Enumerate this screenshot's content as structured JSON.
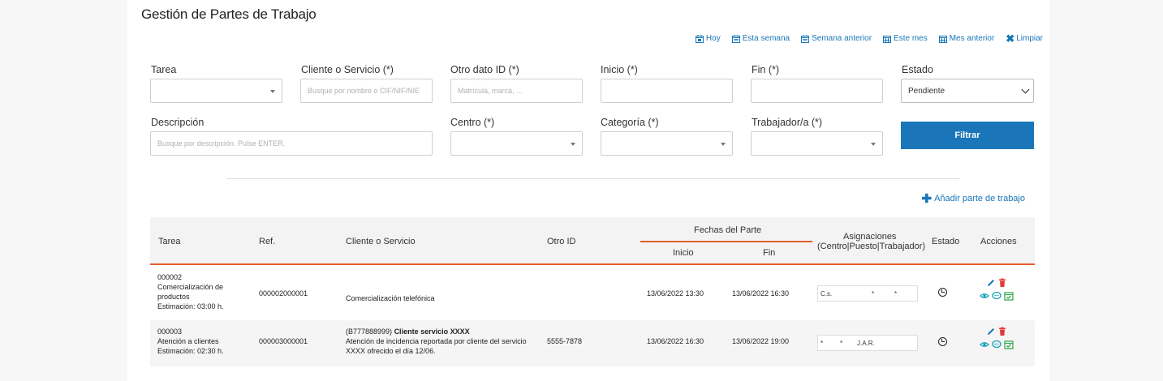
{
  "page": {
    "title": "Gestión de Partes de Trabajo"
  },
  "quick_dates": [
    {
      "label": "Hoy"
    },
    {
      "label": "Esta semana"
    },
    {
      "label": "Semana anterior"
    },
    {
      "label": "Este mes"
    },
    {
      "label": "Mes anterior"
    },
    {
      "label": "Limpiar"
    }
  ],
  "filters": {
    "tarea": {
      "label": "Tarea",
      "value": ""
    },
    "cliente": {
      "label": "Cliente o Servicio (*)",
      "placeholder": "Busque por nombre o CIF/NIF/NIE"
    },
    "otro_dato": {
      "label": "Otro dato ID (*)",
      "placeholder": "Matrícula, marca, ..."
    },
    "inicio": {
      "label": "Inicio (*)",
      "value": ""
    },
    "fin": {
      "label": "Fin (*)",
      "value": ""
    },
    "estado": {
      "label": "Estado",
      "value": "Pendiente"
    },
    "descripcion": {
      "label": "Descripción",
      "placeholder": "Busque por descripción. Pulse ENTER."
    },
    "centro": {
      "label": "Centro (*)",
      "value": ""
    },
    "categoria": {
      "label": "Categoría (*)",
      "value": ""
    },
    "trabajador": {
      "label": "Trabajador/a (*)",
      "value": ""
    },
    "filter_button": "Filtrar"
  },
  "add_link": "Añadir parte de trabajo",
  "table": {
    "headers": {
      "tarea": "Tarea",
      "ref": "Ref.",
      "cliente": "Cliente o Servicio",
      "otro_id": "Otro ID",
      "fechas_group": "Fechas del Parte",
      "inicio": "Inicio",
      "fin": "Fin",
      "asignaciones_1": "Asignaciones",
      "asignaciones_2": "(Centro|Puesto|Trabajador)",
      "estado": "Estado",
      "acciones": "Acciones"
    },
    "rows": [
      {
        "tarea_code": "000002",
        "tarea_name_1": "Comercialización de",
        "tarea_name_2": "productos",
        "estimacion": "Estimación: 03:00 h.",
        "ref": "000002000001",
        "cliente_line1_prefix": "",
        "cliente_line1_bold": "",
        "cliente_line2": "Comercialización telefónica",
        "cliente_line3": "",
        "otro_id": "",
        "inicio": "13/06/2022 13:30",
        "fin": "13/06/2022 16:30",
        "asg_centro": "C.s.",
        "asg_puesto": "*",
        "asg_trabajador": "*"
      },
      {
        "tarea_code": "000003",
        "tarea_name_1": "Atención a clientes",
        "tarea_name_2": "",
        "estimacion": "Estimación: 02:30 h.",
        "ref": "000003000001",
        "cliente_line1_prefix": "(B777888999)",
        "cliente_line1_bold": "Cliente servicio XXXX",
        "cliente_line2": "Atención de incidencia reportada por cliente del servicio",
        "cliente_line3": "XXXX ofrecido el día 12/06.",
        "otro_id": "5555-7878",
        "inicio": "13/06/2022 16:30",
        "fin": "13/06/2022 19:00",
        "asg_centro": "*",
        "asg_puesto": "*",
        "asg_trabajador": "J.A.R."
      }
    ]
  },
  "colors": {
    "primary": "#1a76b8",
    "accent": "#e35d2e",
    "delete": "#e53935",
    "teal": "#17a2b8",
    "green": "#28a745"
  }
}
